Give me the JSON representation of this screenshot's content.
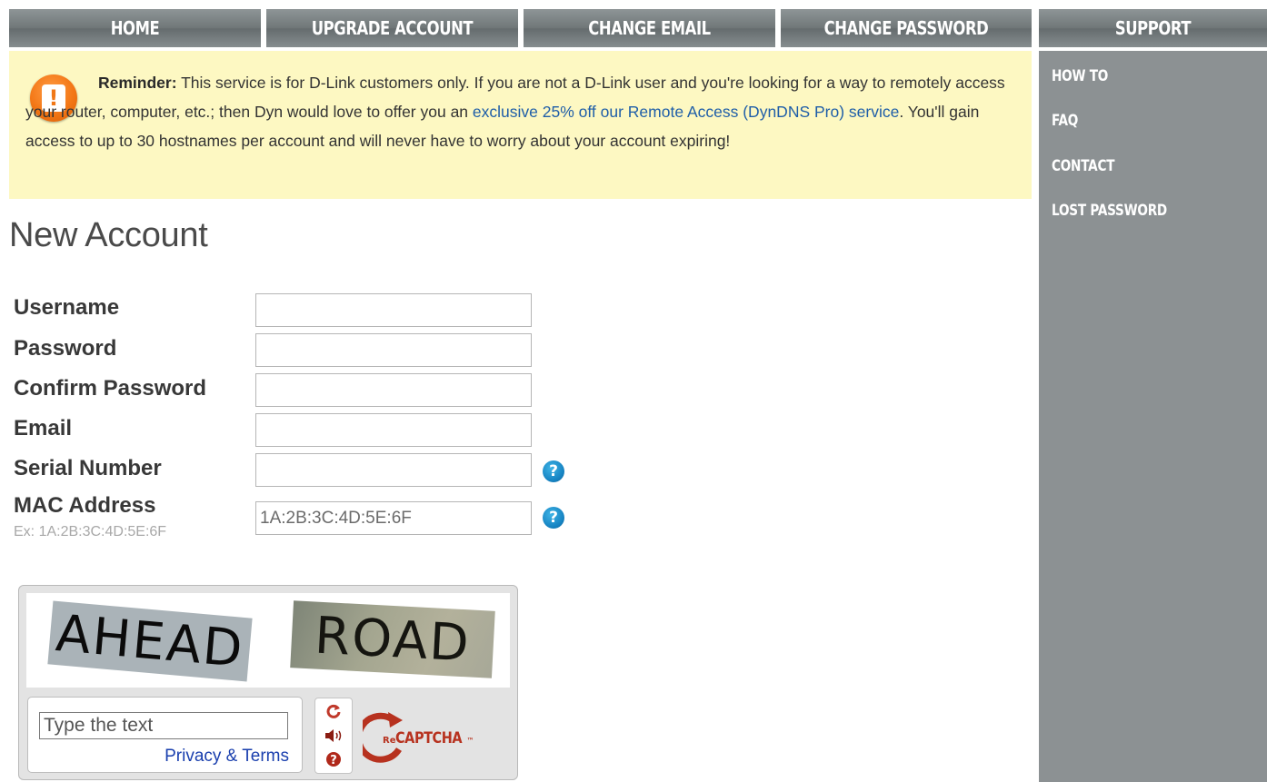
{
  "nav": {
    "tabs": [
      {
        "label": "HOME"
      },
      {
        "label": "UPGRADE ACCOUNT"
      },
      {
        "label": "CHANGE EMAIL"
      },
      {
        "label": "CHANGE PASSWORD"
      }
    ],
    "support_label": "SUPPORT"
  },
  "sidebar": {
    "items": [
      {
        "label": "HOW TO"
      },
      {
        "label": "FAQ"
      },
      {
        "label": "CONTACT"
      },
      {
        "label": "LOST PASSWORD"
      }
    ]
  },
  "reminder": {
    "icon": "exclamation-icon",
    "lead": "Reminder:",
    "text_before": " This service is for D-Link customers only. If you are not a D-Link user and you're looking for a way to remotely access your router, computer, etc.; then Dyn would love to offer you an ",
    "link_text": "exclusive 25% off our Remote Access (DynDNS Pro) service",
    "text_after": ". You'll gain access to up to 30 hostnames per account and will never have to worry about your account expiring!"
  },
  "page_title": "New Account",
  "form": {
    "username_label": "Username",
    "password_label": "Password",
    "confirm_password_label": "Confirm Password",
    "email_label": "Email",
    "serial_label": "Serial Number",
    "mac_label": "MAC Address",
    "mac_example": "Ex: 1A:2B:3C:4D:5E:6F",
    "mac_placeholder": "1A:2B:3C:4D:5E:6F",
    "help_glyph": "?"
  },
  "captcha": {
    "word1": "AHEAD",
    "word2": "ROAD",
    "input_placeholder": "Type the text",
    "privacy_link": "Privacy & Terms",
    "brand_prefix": "Re",
    "brand": "CAPTCHA",
    "trademark": "™"
  },
  "colors": {
    "nav_gray": "#6f7678",
    "sidebar_gray": "#8c9193",
    "reminder_bg": "#fdf8c2",
    "link_blue": "#1f5ea8",
    "warn_orange": "#f37716",
    "help_blue": "#1683c2",
    "recaptcha_red": "#c0392b"
  }
}
